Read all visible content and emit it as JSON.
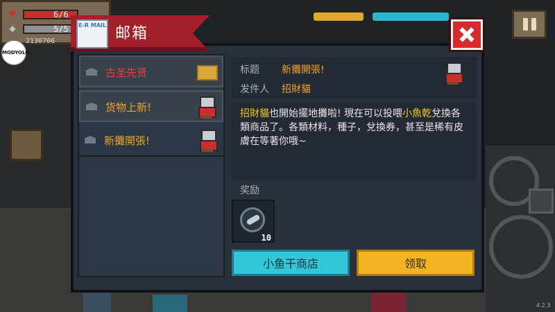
{
  "hud": {
    "hp_text": "6/6",
    "armor_text": "5/5",
    "coins": "2130706",
    "hp_icon": "heart-icon",
    "armor_icon": "shield-icon"
  },
  "watermark": "MODYOLO",
  "version": "4.2.3",
  "mailbox": {
    "title": "邮箱",
    "mail_icon_text": "E-R MAIL",
    "items": [
      {
        "label": "古圣先贤",
        "color": "red",
        "thumb": "gold-badge-icon",
        "selected": false
      },
      {
        "label": "货物上新!",
        "color": "orange",
        "thumb": "cat-merchant-icon",
        "selected": false
      },
      {
        "label": "新攤開張!",
        "color": "orange",
        "thumb": "cat-merchant-icon",
        "selected": false
      }
    ],
    "detail": {
      "subject_label": "标题",
      "subject": "新攤開張!",
      "sender_label": "发件人",
      "sender": "招財貓",
      "body_hl1": "招財貓",
      "body_p1": "也開始擺地攤啦!  現在可以投喂",
      "body_hl2": "小魚乾",
      "body_p2": "兌換各類商品了。各類材料，種子，兌換券，甚至是稀有皮膚在等著你哦~",
      "reward_label": "奖励",
      "reward_qty": "10",
      "reward_icon": "dried-fish-icon"
    },
    "buttons": {
      "shop": "小鱼干商店",
      "claim": "领取"
    }
  },
  "colors": {
    "accent_red": "#a3202b",
    "highlight_yellow": "#f2c71f",
    "title_orange": "#f0a32d",
    "shop_button": "#33c6d8",
    "claim_button": "#f2b522"
  }
}
